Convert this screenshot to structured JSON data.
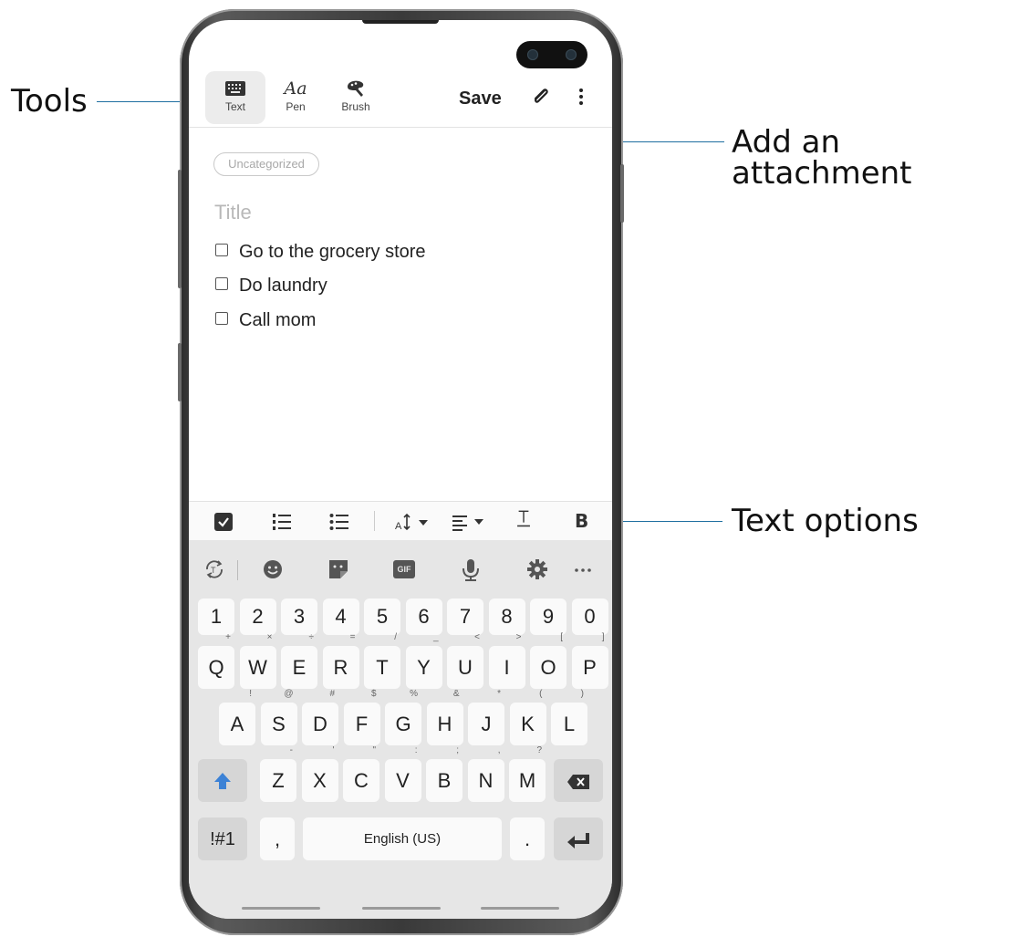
{
  "callouts": {
    "tools": "Tools",
    "attachment": "Add an attachment",
    "text_options": "Text options"
  },
  "toolbar": {
    "tools": [
      {
        "label": "Text",
        "icon": "keyboard-icon"
      },
      {
        "label": "Pen",
        "icon": "pen-text-icon"
      },
      {
        "label": "Brush",
        "icon": "brush-icon"
      }
    ],
    "save_label": "Save",
    "attach_icon": "paperclip-icon",
    "more_icon": "more-vert-icon"
  },
  "note": {
    "category": "Uncategorized",
    "title_placeholder": "Title",
    "checklist": [
      "Go to the grocery store",
      "Do laundry",
      "Call mom"
    ]
  },
  "text_options_bar": [
    "checkbox-icon",
    "numbered-list-icon",
    "bulleted-list-icon",
    "font-size-icon",
    "align-icon",
    "text-color-icon",
    "bold-icon"
  ],
  "bold_label": "B",
  "keyboard": {
    "toolbar_icons": [
      "translate-icon",
      "emoji-icon",
      "sticker-icon",
      "gif-icon",
      "microphone-icon",
      "settings-icon",
      "more-horiz-icon"
    ],
    "gif_label": "GIF",
    "numbers": [
      "1",
      "2",
      "3",
      "4",
      "5",
      "6",
      "7",
      "8",
      "9",
      "0"
    ],
    "row1": [
      {
        "k": "Q",
        "h": "+"
      },
      {
        "k": "W",
        "h": "×"
      },
      {
        "k": "E",
        "h": "÷"
      },
      {
        "k": "R",
        "h": "="
      },
      {
        "k": "T",
        "h": "/"
      },
      {
        "k": "Y",
        "h": "_"
      },
      {
        "k": "U",
        "h": "<"
      },
      {
        "k": "I",
        "h": ">"
      },
      {
        "k": "O",
        "h": "["
      },
      {
        "k": "P",
        "h": "]"
      }
    ],
    "row2": [
      {
        "k": "A",
        "h": "!"
      },
      {
        "k": "S",
        "h": "@"
      },
      {
        "k": "D",
        "h": "#"
      },
      {
        "k": "F",
        "h": "$"
      },
      {
        "k": "G",
        "h": "%"
      },
      {
        "k": "H",
        "h": "&"
      },
      {
        "k": "J",
        "h": "*"
      },
      {
        "k": "K",
        "h": "("
      },
      {
        "k": "L",
        "h": ")"
      }
    ],
    "row3": [
      {
        "k": "Z",
        "h": "-"
      },
      {
        "k": "X",
        "h": "'"
      },
      {
        "k": "C",
        "h": "\""
      },
      {
        "k": "V",
        "h": ":"
      },
      {
        "k": "B",
        "h": ";"
      },
      {
        "k": "N",
        "h": ","
      },
      {
        "k": "M",
        "h": "?"
      }
    ],
    "symbols_label": "!#1",
    "comma_label": ",",
    "space_label": "English (US)",
    "period_label": ".",
    "accent_color": "#3c82d6"
  }
}
